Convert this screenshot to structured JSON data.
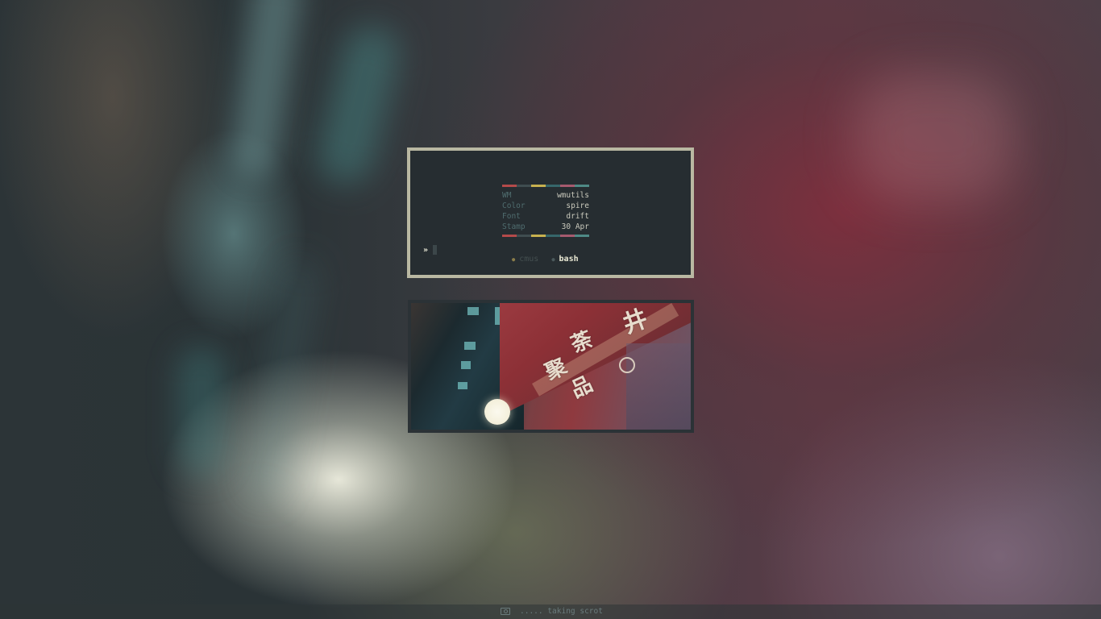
{
  "terminal": {
    "palette": [
      "#b44a4a",
      "#3f4d50",
      "#c7b14f",
      "#36666a",
      "#a65a6e",
      "#4e8a86"
    ],
    "info": [
      {
        "key": "WM",
        "value": "wmutils"
      },
      {
        "key": "Color",
        "value": "spire"
      },
      {
        "key": "Font",
        "value": "drift"
      },
      {
        "key": "Stamp",
        "value": "30 Apr"
      }
    ],
    "prompt_symbol": "»",
    "tabs": [
      {
        "label": "cmus",
        "active": false
      },
      {
        "label": "bash",
        "active": true
      }
    ]
  },
  "viewer": {
    "sign_text": [
      "井",
      "荼",
      "聚",
      "品"
    ]
  },
  "statusbar": {
    "icon": "camera-icon",
    "text": "..... taking scrot"
  }
}
